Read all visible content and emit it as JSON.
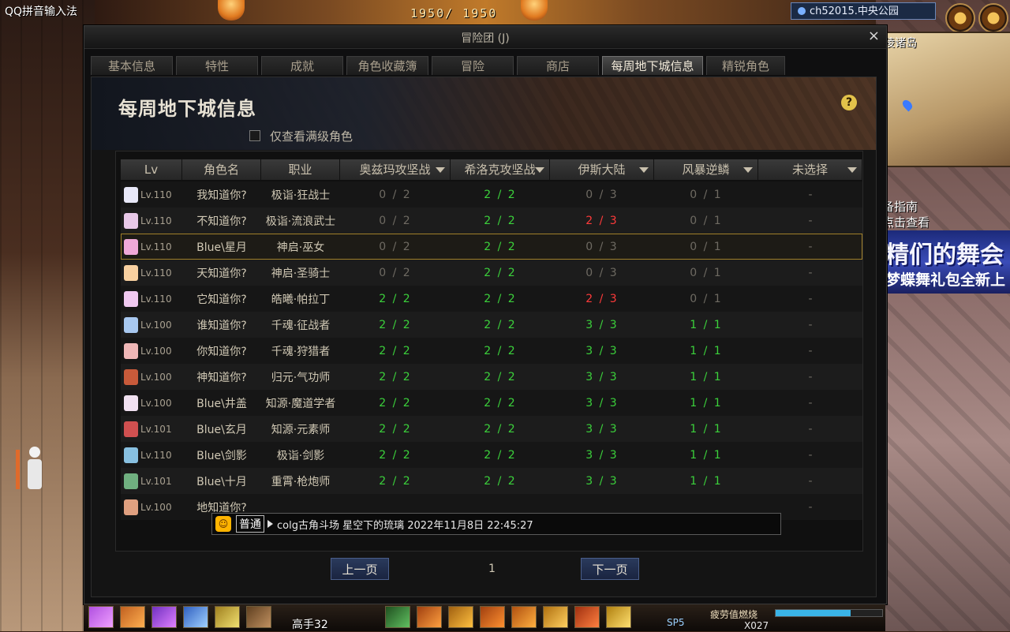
{
  "system": {
    "ime": "QQ拼音输入法"
  },
  "hud": {
    "top_counter": "1950/ 1950",
    "server": "ch52015.中央公园",
    "minimap_title": "陵诸岛",
    "guide_line1": "备指南",
    "guide_line2": "点击查看",
    "banner_line1": "精们的舞会",
    "banner_line2": "梦蝶舞礼包全新上",
    "level": "高手32",
    "sp": "SP5",
    "fatigue": "疲劳值燃烧",
    "x_count": "X027"
  },
  "window": {
    "title": "冒险团 (J)",
    "close": "×",
    "tabs": [
      {
        "label": "基本信息",
        "active": false
      },
      {
        "label": "特性",
        "active": false
      },
      {
        "label": "成就",
        "active": false
      },
      {
        "label": "角色收藏簿",
        "active": false
      },
      {
        "label": "冒险",
        "active": false
      },
      {
        "label": "商店",
        "active": false
      },
      {
        "label": "每周地下城信息",
        "active": true
      },
      {
        "label": "精锐角色",
        "active": false
      }
    ]
  },
  "page": {
    "heading": "每周地下城信息",
    "help": "?",
    "filter_label": "仅查看满级角色",
    "filter_checked": false
  },
  "table": {
    "columns": [
      {
        "label": "Lv",
        "dropdown": false
      },
      {
        "label": "角色名",
        "dropdown": false
      },
      {
        "label": "职业",
        "dropdown": false
      },
      {
        "label": "奥兹玛攻坚战",
        "dropdown": true
      },
      {
        "label": "希洛克攻坚战",
        "dropdown": true
      },
      {
        "label": "伊斯大陆",
        "dropdown": true
      },
      {
        "label": "风暴逆鳞",
        "dropdown": true
      },
      {
        "label": "未选择",
        "dropdown": true
      }
    ],
    "rows": [
      {
        "lv": "Lv.110",
        "name": "我知道你?",
        "job": "极诣·狂战士",
        "d1": "0 / 2",
        "d1c": "gray",
        "d2": "2 / 2",
        "d2c": "green",
        "d3": "0 / 3",
        "d3c": "gray",
        "d4": "0 / 1",
        "d4c": "gray",
        "d5": "-",
        "avatar": "#e8e8f8"
      },
      {
        "lv": "Lv.110",
        "name": "不知道你?",
        "job": "极诣·流浪武士",
        "d1": "0 / 2",
        "d1c": "gray",
        "d2": "2 / 2",
        "d2c": "green",
        "d3": "2 / 3",
        "d3c": "red",
        "d4": "0 / 1",
        "d4c": "gray",
        "d5": "-",
        "avatar": "#e8c8e8"
      },
      {
        "lv": "Lv.110",
        "name": "Blue\\星月",
        "job": "神启·巫女",
        "d1": "0 / 2",
        "d1c": "gray",
        "d2": "2 / 2",
        "d2c": "green",
        "d3": "0 / 3",
        "d3c": "gray",
        "d4": "0 / 1",
        "d4c": "gray",
        "d5": "-",
        "avatar": "#f0a8d8",
        "selected": true
      },
      {
        "lv": "Lv.110",
        "name": "天知道你?",
        "job": "神启·圣骑士",
        "d1": "0 / 2",
        "d1c": "gray",
        "d2": "2 / 2",
        "d2c": "green",
        "d3": "0 / 3",
        "d3c": "gray",
        "d4": "0 / 1",
        "d4c": "gray",
        "d5": "-",
        "avatar": "#f8d0a0"
      },
      {
        "lv": "Lv.110",
        "name": "它知道你?",
        "job": "皓曦·帕拉丁",
        "d1": "2 / 2",
        "d1c": "green",
        "d2": "2 / 2",
        "d2c": "green",
        "d3": "2 / 3",
        "d3c": "red",
        "d4": "0 / 1",
        "d4c": "gray",
        "d5": "-",
        "avatar": "#f0c8f0"
      },
      {
        "lv": "Lv.100",
        "name": "谁知道你?",
        "job": "千魂·征战者",
        "d1": "2 / 2",
        "d1c": "green",
        "d2": "2 / 2",
        "d2c": "green",
        "d3": "3 / 3",
        "d3c": "green",
        "d4": "1 / 1",
        "d4c": "green",
        "d5": "-",
        "avatar": "#a8c8f0"
      },
      {
        "lv": "Lv.100",
        "name": "你知道你?",
        "job": "千魂·狩猎者",
        "d1": "2 / 2",
        "d1c": "green",
        "d2": "2 / 2",
        "d2c": "green",
        "d3": "3 / 3",
        "d3c": "green",
        "d4": "1 / 1",
        "d4c": "green",
        "d5": "-",
        "avatar": "#f0b8b8"
      },
      {
        "lv": "Lv.100",
        "name": "神知道你?",
        "job": "归元·气功师",
        "d1": "2 / 2",
        "d1c": "green",
        "d2": "2 / 2",
        "d2c": "green",
        "d3": "3 / 3",
        "d3c": "green",
        "d4": "1 / 1",
        "d4c": "green",
        "d5": "-",
        "avatar": "#c85a3a"
      },
      {
        "lv": "Lv.100",
        "name": "Blue\\井盖",
        "job": "知源·魔道学者",
        "d1": "2 / 2",
        "d1c": "green",
        "d2": "2 / 2",
        "d2c": "green",
        "d3": "3 / 3",
        "d3c": "green",
        "d4": "1 / 1",
        "d4c": "green",
        "d5": "-",
        "avatar": "#f0e0f0"
      },
      {
        "lv": "Lv.101",
        "name": "Blue\\玄月",
        "job": "知源·元素师",
        "d1": "2 / 2",
        "d1c": "green",
        "d2": "2 / 2",
        "d2c": "green",
        "d3": "3 / 3",
        "d3c": "green",
        "d4": "1 / 1",
        "d4c": "green",
        "d5": "-",
        "avatar": "#d05050"
      },
      {
        "lv": "Lv.110",
        "name": "Blue\\剑影",
        "job": "极诣·剑影",
        "d1": "2 / 2",
        "d1c": "green",
        "d2": "2 / 2",
        "d2c": "green",
        "d3": "3 / 3",
        "d3c": "green",
        "d4": "1 / 1",
        "d4c": "green",
        "d5": "-",
        "avatar": "#88c0e0"
      },
      {
        "lv": "Lv.101",
        "name": "Blue\\十月",
        "job": "重霄·枪炮师",
        "d1": "2 / 2",
        "d1c": "green",
        "d2": "2 / 2",
        "d2c": "green",
        "d3": "3 / 3",
        "d3c": "green",
        "d4": "1 / 1",
        "d4c": "green",
        "d5": "-",
        "avatar": "#70b080"
      },
      {
        "lv": "Lv.100",
        "name": "地知道你?",
        "job": "",
        "d1": "",
        "d1c": "gray",
        "d2": "",
        "d2c": "green",
        "d3": "",
        "d3c": "gray",
        "d4": "",
        "d4c": "gray",
        "d5": "-",
        "avatar": "#e0a080"
      }
    ]
  },
  "tooltip": {
    "channel": "普通",
    "text": "colg古角斗场 星空下的琉璃 2022年11月8日 22:45:27"
  },
  "pager": {
    "prev": "上一页",
    "page": "1",
    "next": "下一页"
  }
}
